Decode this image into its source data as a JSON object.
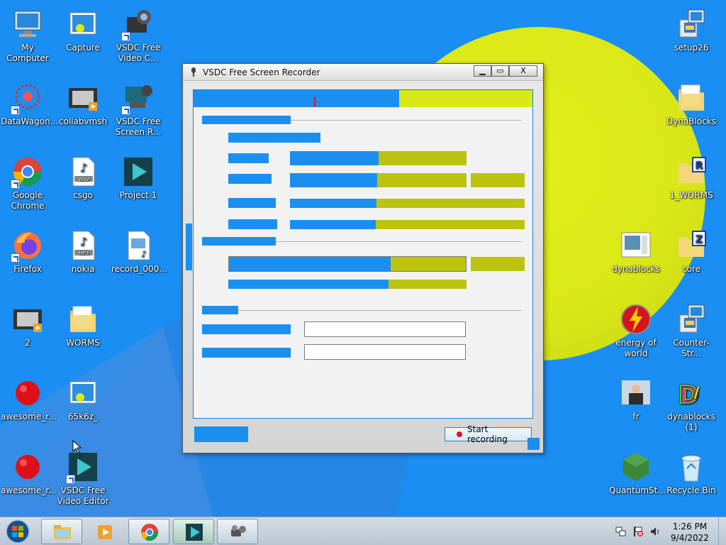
{
  "desktop": {
    "icons_left": [
      {
        "label": "My Computer",
        "icon": "computer-icon"
      },
      {
        "label": "Capture",
        "icon": "image-file-icon"
      },
      {
        "label": "VSDC Free Video C...",
        "icon": "vsdc-converter-icon"
      },
      {
        "label": "DataWagon...",
        "icon": "datawagon-icon"
      },
      {
        "label": "collabvmsh",
        "icon": "video-file-icon"
      },
      {
        "label": "VSDC Free Screen R...",
        "icon": "vsdc-screen-recorder-icon"
      },
      {
        "label": "Google Chrome",
        "icon": "chrome-icon"
      },
      {
        "label": "csgo",
        "icon": "wav-file-icon"
      },
      {
        "label": "Project 1",
        "icon": "vsdc-project-icon"
      },
      {
        "label": "Firefox",
        "icon": "firefox-icon"
      },
      {
        "label": "nokia",
        "icon": "mp3-file-icon"
      },
      {
        "label": "record_000...",
        "icon": "media-file-icon"
      },
      {
        "label": "2",
        "icon": "video-file-icon"
      },
      {
        "label": "WORMS",
        "icon": "folder-icon"
      },
      {
        "label": "awesome_r...",
        "icon": "red-ball-icon"
      },
      {
        "label": "65k6z_",
        "icon": "image-file-icon"
      },
      {
        "label": "awesome_r...",
        "icon": "red-ball-icon"
      },
      {
        "label": "VSDC Free Video Editor",
        "icon": "vsdc-editor-icon"
      }
    ],
    "icons_right": [
      {
        "label": "setup26",
        "icon": "installer-icon"
      },
      {
        "label": "DynaBlocks",
        "icon": "folder-icon"
      },
      {
        "label": "1_WORMS",
        "icon": "rar-archive-icon"
      },
      {
        "label": "dynablocks",
        "icon": "window-file-icon"
      },
      {
        "label": "core",
        "icon": "zip-archive-icon"
      },
      {
        "label": "energy of world",
        "icon": "energy-icon"
      },
      {
        "label": "Counter-Str...",
        "icon": "installer-icon"
      },
      {
        "label": "fr",
        "icon": "photo-icon"
      },
      {
        "label": "dynablocks (1)",
        "icon": "dynablocks-logo-icon"
      },
      {
        "label": "QuantumSt...",
        "icon": "nodejs-icon"
      },
      {
        "label": "Recycle Bin",
        "icon": "recycle-bin-icon"
      }
    ]
  },
  "window": {
    "title": "VSDC Free Screen Recorder",
    "min_label": "▁",
    "max_label": "▭",
    "close_label": "X",
    "start_recording_label": "Start recording"
  },
  "taskbar": {
    "time": "1:26 PM",
    "date": "9/4/2022",
    "items": [
      "explorer",
      "media-player",
      "chrome",
      "vsdc-editor",
      "vsdc-screen-recorder"
    ]
  },
  "colors": {
    "desktop_blue": "#1a8ef2",
    "ball_yellow": "#dbe817",
    "record_red": "#e0102a"
  }
}
